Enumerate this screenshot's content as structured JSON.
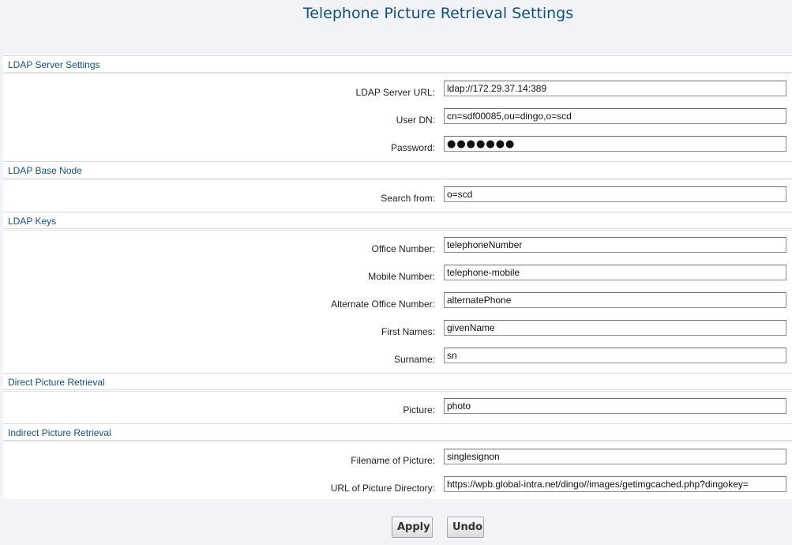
{
  "page": {
    "title": "Telephone Picture Retrieval Settings"
  },
  "sections": {
    "ldap_server": {
      "header": "LDAP Server Settings",
      "fields": {
        "server_url": {
          "label": "LDAP Server URL:",
          "value": "ldap://172.29.37.14:389"
        },
        "user_dn": {
          "label": "User DN:",
          "value": "cn=sdf00085,ou=dingo,o=scd"
        },
        "password": {
          "label": "Password:",
          "value": "●●●●●●●"
        }
      }
    },
    "base_node": {
      "header": "LDAP Base Node",
      "fields": {
        "search_from": {
          "label": "Search from:",
          "value": "o=scd"
        }
      }
    },
    "ldap_keys": {
      "header": "LDAP Keys",
      "fields": {
        "office_number": {
          "label": "Office Number:",
          "value": "telephoneNumber"
        },
        "mobile_number": {
          "label": "Mobile Number:",
          "value": "telephone-mobile"
        },
        "alternate_office": {
          "label": "Alternate Office Number:",
          "value": "alternatePhone"
        },
        "first_names": {
          "label": "First Names:",
          "value": "givenName"
        },
        "surname": {
          "label": "Surname:",
          "value": "sn"
        }
      }
    },
    "direct_picture": {
      "header": "Direct Picture Retrieval",
      "fields": {
        "picture": {
          "label": "Picture:",
          "value": "photo"
        }
      }
    },
    "indirect_picture": {
      "header": "Indirect Picture Retrieval",
      "fields": {
        "filename": {
          "label": "Filename of Picture:",
          "value": "singlesignon"
        },
        "directory_url": {
          "label": "URL of Picture Directory:",
          "value": "https://wpb.global-intra.net/dingo//images/getimgcached.php?dingokey="
        }
      }
    }
  },
  "buttons": {
    "apply": "Apply",
    "undo": "Undo"
  },
  "colors": {
    "accent": "#14507e",
    "background": "#f1f3f6",
    "panel": "#ffffff"
  }
}
